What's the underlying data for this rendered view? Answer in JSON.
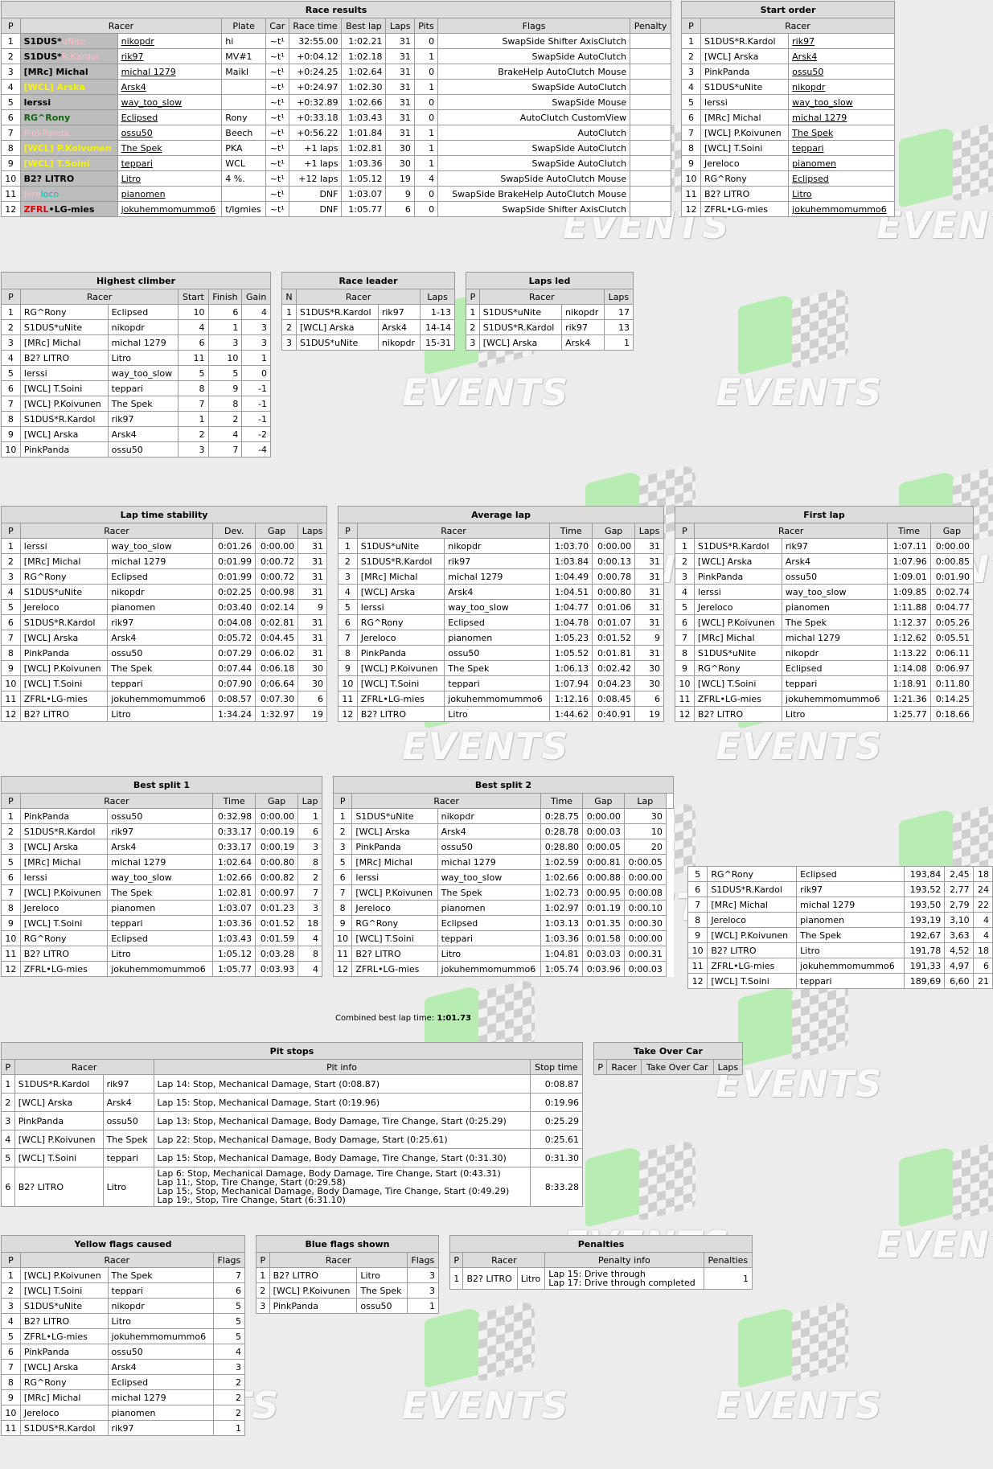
{
  "watermark": {
    "text": "EVENTS"
  },
  "race_results": {
    "title": "Race results",
    "columns": [
      "P",
      "Racer",
      "",
      "Plate",
      "Car",
      "Race time",
      "Best lap",
      "Laps",
      "Pits",
      "Flags",
      "Penalty"
    ],
    "rows": [
      {
        "p": "1",
        "racer_a": "S1DUS*",
        "racer_b": "uNite",
        "user": "nikopdr",
        "plate": "hi",
        "car": "~t¹",
        "time": "32:55.00",
        "best": "1:02.21",
        "laps": "31",
        "pits": "0",
        "flags": "SwapSide Shifter AxisClutch",
        "penalty": ""
      },
      {
        "p": "2",
        "racer_a": "S1DUS*",
        "racer_b": "R.Kardol",
        "user": "rik97",
        "plate": "MV#1",
        "car": "~t¹",
        "time": "+0:04.12",
        "best": "1:02.18",
        "laps": "31",
        "pits": "1",
        "flags": "SwapSide AutoClutch",
        "penalty": ""
      },
      {
        "p": "3",
        "racer_a": "[MR",
        "racer_b": "c] Michal",
        "user": "michal 1279",
        "plate": "Maikl",
        "car": "~t¹",
        "time": "+0:24.25",
        "best": "1:02.64",
        "laps": "31",
        "pits": "0",
        "flags": "BrakeHelp AutoClutch Mouse",
        "penalty": ""
      },
      {
        "p": "4",
        "racer_a": "[WCL]",
        "racer_b": " Arska",
        "user": "Arsk4",
        "plate": "",
        "car": "~t¹",
        "time": "+0:24.97",
        "best": "1:02.30",
        "laps": "31",
        "pits": "1",
        "flags": "SwapSide AutoClutch",
        "penalty": ""
      },
      {
        "p": "5",
        "racer_a": "lerssi",
        "racer_b": "",
        "user": "way_too_slow",
        "plate": "",
        "car": "~t¹",
        "time": "+0:32.89",
        "best": "1:02.66",
        "laps": "31",
        "pits": "0",
        "flags": "SwapSide Mouse",
        "penalty": ""
      },
      {
        "p": "6",
        "racer_a": "RG^",
        "racer_b": "Rony",
        "user": "Eclipsed",
        "plate": "Rony",
        "car": "~t¹",
        "time": "+0:33.18",
        "best": "1:03.43",
        "laps": "31",
        "pits": "0",
        "flags": "AutoClutch CustomView",
        "penalty": ""
      },
      {
        "p": "7",
        "racer_a": "Pink",
        "racer_b": "Panda",
        "user": "ossu50",
        "plate": "Beech",
        "car": "~t¹",
        "time": "+0:56.22",
        "best": "1:01.84",
        "laps": "31",
        "pits": "1",
        "flags": "AutoClutch",
        "penalty": ""
      },
      {
        "p": "8",
        "racer_a": "[WCL]",
        "racer_b": " P.Koivunen",
        "user": "The Spek",
        "plate": "PKA",
        "car": "~t¹",
        "time": "+1 laps",
        "best": "1:02.81",
        "laps": "30",
        "pits": "1",
        "flags": "SwapSide AutoClutch",
        "penalty": ""
      },
      {
        "p": "9",
        "racer_a": "[WCL]",
        "racer_b": " T.Soini",
        "user": "teppari",
        "plate": "WCL",
        "car": "~t¹",
        "time": "+1 laps",
        "best": "1:03.36",
        "laps": "30",
        "pits": "1",
        "flags": "SwapSide AutoClutch",
        "penalty": ""
      },
      {
        "p": "10",
        "racer_a": "B2?",
        "racer_b": " LITRO",
        "user": "Litro",
        "plate": "4 %.",
        "car": "~t¹",
        "time": "+12 laps",
        "best": "1:05.12",
        "laps": "19",
        "pits": "4",
        "flags": "SwapSide AutoClutch Mouse",
        "penalty": ""
      },
      {
        "p": "11",
        "racer_a": "Jere",
        "racer_b": "loco",
        "user": "pianomen",
        "plate": "",
        "car": "~t¹",
        "time": "DNF",
        "best": "1:03.07",
        "laps": "9",
        "pits": "0",
        "flags": "SwapSide BrakeHelp AutoClutch Mouse",
        "penalty": ""
      },
      {
        "p": "12",
        "racer_a": "ZFRL",
        "racer_b": "•LG-mies",
        "user": "jokuhemmomummo6",
        "plate": "t/lgmies",
        "car": "~t¹",
        "time": "DNF",
        "best": "1:05.77",
        "laps": "6",
        "pits": "0",
        "flags": "SwapSide Shifter AxisClutch",
        "penalty": ""
      }
    ]
  },
  "start_order": {
    "title": "Start order",
    "columns": [
      "P",
      "Racer"
    ],
    "rows": [
      [
        "1",
        "S1DUS*R.Kardol",
        "rik97"
      ],
      [
        "2",
        "[WCL] Arska",
        "Arsk4"
      ],
      [
        "3",
        "PinkPanda",
        "ossu50"
      ],
      [
        "4",
        "S1DUS*uNite",
        "nikopdr"
      ],
      [
        "5",
        "lerssi",
        "way_too_slow"
      ],
      [
        "6",
        "[MRc] Michal",
        "michal 1279"
      ],
      [
        "7",
        "[WCL] P.Koivunen",
        "The Spek"
      ],
      [
        "8",
        "[WCL] T.Soini",
        "teppari"
      ],
      [
        "9",
        "Jereloco",
        "pianomen"
      ],
      [
        "10",
        "RG^Rony",
        "Eclipsed"
      ],
      [
        "11",
        "B2? LITRO",
        "Litro"
      ],
      [
        "12",
        "ZFRL•LG-mies",
        "jokuhemmomummo6"
      ]
    ]
  },
  "highest_climber": {
    "title": "Highest climber",
    "columns": [
      "P",
      "Racer",
      "Start",
      "Finish",
      "Gain"
    ],
    "rows": [
      [
        "1",
        "RG^Rony",
        "Eclipsed",
        "10",
        "6",
        "4"
      ],
      [
        "2",
        "S1DUS*uNite",
        "nikopdr",
        "4",
        "1",
        "3"
      ],
      [
        "3",
        "[MRc] Michal",
        "michal 1279",
        "6",
        "3",
        "3"
      ],
      [
        "4",
        "B2? LITRO",
        "Litro",
        "11",
        "10",
        "1"
      ],
      [
        "5",
        "lerssi",
        "way_too_slow",
        "5",
        "5",
        "0"
      ],
      [
        "6",
        "[WCL] T.Soini",
        "teppari",
        "8",
        "9",
        "-1"
      ],
      [
        "7",
        "[WCL] P.Koivunen",
        "The Spek",
        "7",
        "8",
        "-1"
      ],
      [
        "8",
        "S1DUS*R.Kardol",
        "rik97",
        "1",
        "2",
        "-1"
      ],
      [
        "9",
        "[WCL] Arska",
        "Arsk4",
        "2",
        "4",
        "-2"
      ],
      [
        "10",
        "PinkPanda",
        "ossu50",
        "3",
        "7",
        "-4"
      ]
    ]
  },
  "race_leader": {
    "title": "Race leader",
    "columns": [
      "N",
      "Racer",
      "Laps"
    ],
    "rows": [
      [
        "1",
        "S1DUS*R.Kardol",
        "rik97",
        "1-13"
      ],
      [
        "2",
        "[WCL] Arska",
        "Arsk4",
        "14-14"
      ],
      [
        "3",
        "S1DUS*uNite",
        "nikopdr",
        "15-31"
      ]
    ]
  },
  "laps_led": {
    "title": "Laps led",
    "columns": [
      "P",
      "Racer",
      "Laps"
    ],
    "rows": [
      [
        "1",
        "S1DUS*uNite",
        "nikopdr",
        "17"
      ],
      [
        "2",
        "S1DUS*R.Kardol",
        "rik97",
        "13"
      ],
      [
        "3",
        "[WCL] Arska",
        "Arsk4",
        "1"
      ]
    ]
  },
  "lap_stability": {
    "title": "Lap time stability",
    "columns": [
      "P",
      "Racer",
      "Dev.",
      "Gap",
      "Laps"
    ],
    "rows": [
      [
        "1",
        "lerssi",
        "way_too_slow",
        "0:01.26",
        "0:00.00",
        "31"
      ],
      [
        "2",
        "[MRc] Michal",
        "michal 1279",
        "0:01.99",
        "0:00.72",
        "31"
      ],
      [
        "3",
        "RG^Rony",
        "Eclipsed",
        "0:01.99",
        "0:00.72",
        "31"
      ],
      [
        "4",
        "S1DUS*uNite",
        "nikopdr",
        "0:02.25",
        "0:00.98",
        "31"
      ],
      [
        "5",
        "Jereloco",
        "pianomen",
        "0:03.40",
        "0:02.14",
        "9"
      ],
      [
        "6",
        "S1DUS*R.Kardol",
        "rik97",
        "0:04.08",
        "0:02.81",
        "31"
      ],
      [
        "7",
        "[WCL] Arska",
        "Arsk4",
        "0:05.72",
        "0:04.45",
        "31"
      ],
      [
        "8",
        "PinkPanda",
        "ossu50",
        "0:07.29",
        "0:06.02",
        "31"
      ],
      [
        "9",
        "[WCL] P.Koivunen",
        "The Spek",
        "0:07.44",
        "0:06.18",
        "30"
      ],
      [
        "10",
        "[WCL] T.Soini",
        "teppari",
        "0:07.90",
        "0:06.64",
        "30"
      ],
      [
        "11",
        "ZFRL•LG-mies",
        "jokuhemmomummo6",
        "0:08.57",
        "0:07.30",
        "6"
      ],
      [
        "12",
        "B2? LITRO",
        "Litro",
        "1:34.24",
        "1:32.97",
        "19"
      ]
    ]
  },
  "average_lap": {
    "title": "Average lap",
    "columns": [
      "P",
      "Racer",
      "Time",
      "Gap",
      "Laps"
    ],
    "rows": [
      [
        "1",
        "S1DUS*uNite",
        "nikopdr",
        "1:03.70",
        "0:00.00",
        "31"
      ],
      [
        "2",
        "S1DUS*R.Kardol",
        "rik97",
        "1:03.84",
        "0:00.13",
        "31"
      ],
      [
        "3",
        "[MRc] Michal",
        "michal 1279",
        "1:04.49",
        "0:00.78",
        "31"
      ],
      [
        "4",
        "[WCL] Arska",
        "Arsk4",
        "1:04.51",
        "0:00.80",
        "31"
      ],
      [
        "5",
        "lerssi",
        "way_too_slow",
        "1:04.77",
        "0:01.06",
        "31"
      ],
      [
        "6",
        "RG^Rony",
        "Eclipsed",
        "1:04.78",
        "0:01.07",
        "31"
      ],
      [
        "7",
        "Jereloco",
        "pianomen",
        "1:05.23",
        "0:01.52",
        "9"
      ],
      [
        "8",
        "PinkPanda",
        "ossu50",
        "1:05.52",
        "0:01.81",
        "31"
      ],
      [
        "9",
        "[WCL] P.Koivunen",
        "The Spek",
        "1:06.13",
        "0:02.42",
        "30"
      ],
      [
        "10",
        "[WCL] T.Soini",
        "teppari",
        "1:07.94",
        "0:04.23",
        "30"
      ],
      [
        "11",
        "ZFRL•LG-mies",
        "jokuhemmomummo6",
        "1:12.16",
        "0:08.45",
        "6"
      ],
      [
        "12",
        "B2? LITRO",
        "Litro",
        "1:44.62",
        "0:40.91",
        "19"
      ]
    ]
  },
  "first_lap": {
    "title": "First lap",
    "columns": [
      "P",
      "Racer",
      "Time",
      "Gap"
    ],
    "rows": [
      [
        "1",
        "S1DUS*R.Kardol",
        "rik97",
        "1:07.11",
        "0:00.00"
      ],
      [
        "2",
        "[WCL] Arska",
        "Arsk4",
        "1:07.96",
        "0:00.85"
      ],
      [
        "3",
        "PinkPanda",
        "ossu50",
        "1:09.01",
        "0:01.90"
      ],
      [
        "4",
        "lerssi",
        "way_too_slow",
        "1:09.85",
        "0:02.74"
      ],
      [
        "5",
        "Jereloco",
        "pianomen",
        "1:11.88",
        "0:04.77"
      ],
      [
        "6",
        "[WCL] P.Koivunen",
        "The Spek",
        "1:12.37",
        "0:05.26"
      ],
      [
        "7",
        "[MRc] Michal",
        "michal 1279",
        "1:12.62",
        "0:05.51"
      ],
      [
        "8",
        "S1DUS*uNite",
        "nikopdr",
        "1:13.22",
        "0:06.11"
      ],
      [
        "9",
        "RG^Rony",
        "Eclipsed",
        "1:14.08",
        "0:06.97"
      ],
      [
        "10",
        "[WCL] T.Soini",
        "teppari",
        "1:18.91",
        "0:11.80"
      ],
      [
        "11",
        "ZFRL•LG-mies",
        "jokuhemmomummo6",
        "1:21.36",
        "0:14.25"
      ],
      [
        "12",
        "B2? LITRO",
        "Litro",
        "1:25.77",
        "0:18.66"
      ]
    ]
  },
  "best_split_1": {
    "title": "Best split 1",
    "columns": [
      "P",
      "Racer",
      "Time",
      "Gap",
      "Lap"
    ],
    "rows": [
      [
        "1",
        "PinkPanda",
        "ossu50",
        "0:32.98",
        "0:00.00",
        "1"
      ],
      [
        "2",
        "S1DUS*R.Kardol",
        "rik97",
        "0:33.17",
        "0:00.19",
        "6"
      ],
      [
        "3",
        "[WCL] Arska",
        "Arsk4",
        "0:33.17",
        "0:00.19",
        "3"
      ],
      [
        "5",
        "[MRc] Michal",
        "michal 1279",
        "1:02.64",
        "0:00.80",
        "8"
      ],
      [
        "6",
        "lerssi",
        "way_too_slow",
        "1:02.66",
        "0:00.82",
        "2"
      ],
      [
        "7",
        "[WCL] P.Koivunen",
        "The Spek",
        "1:02.81",
        "0:00.97",
        "7"
      ],
      [
        "8",
        "Jereloco",
        "pianomen",
        "1:03.07",
        "0:01.23",
        "3"
      ],
      [
        "9",
        "[WCL] T.Soini",
        "teppari",
        "1:03.36",
        "0:01.52",
        "18"
      ],
      [
        "10",
        "RG^Rony",
        "Eclipsed",
        "1:03.43",
        "0:01.59",
        "4"
      ],
      [
        "11",
        "B2? LITRO",
        "Litro",
        "1:05.12",
        "0:03.28",
        "8"
      ],
      [
        "12",
        "ZFRL•LG-mies",
        "jokuhemmomummo6",
        "1:05.77",
        "0:03.93",
        "4"
      ]
    ]
  },
  "best_split_2": {
    "title": "Best split 2",
    "columns": [
      "P",
      "Racer",
      "Time",
      "Gap",
      "Lap"
    ],
    "rows": [
      [
        "1",
        "S1DUS*uNite",
        "nikopdr",
        "0:28.75",
        "0:00.00",
        "30"
      ],
      [
        "2",
        "[WCL] Arska",
        "Arsk4",
        "0:28.78",
        "0:00.03",
        "10"
      ],
      [
        "3",
        "PinkPanda",
        "ossu50",
        "0:28.80",
        "0:00.05",
        "20"
      ],
      [
        "5",
        "[MRc] Michal",
        "michal 1279",
        "1:02.59",
        "0:00.81",
        "0:00.05"
      ],
      [
        "6",
        "lerssi",
        "way_too_slow",
        "1:02.66",
        "0:00.88",
        "0:00.00"
      ],
      [
        "7",
        "[WCL] P.Koivunen",
        "The Spek",
        "1:02.73",
        "0:00.95",
        "0:00.08"
      ],
      [
        "8",
        "Jereloco",
        "pianomen",
        "1:02.97",
        "0:01.19",
        "0:00.10"
      ],
      [
        "9",
        "RG^Rony",
        "Eclipsed",
        "1:03.13",
        "0:01.35",
        "0:00.30"
      ],
      [
        "10",
        "[WCL] T.Soini",
        "teppari",
        "1:03.36",
        "0:01.58",
        "0:00.00"
      ],
      [
        "11",
        "B2? LITRO",
        "Litro",
        "1:04.81",
        "0:03.03",
        "0:00.31"
      ],
      [
        "12",
        "ZFRL•LG-mies",
        "jokuhemmomummo6",
        "1:05.74",
        "0:03.96",
        "0:00.03"
      ]
    ]
  },
  "top_speed_partial": {
    "rows": [
      [
        "5",
        "RG^Rony",
        "Eclipsed",
        "193,84",
        "2,45",
        "18"
      ],
      [
        "6",
        "S1DUS*R.Kardol",
        "rik97",
        "193,52",
        "2,77",
        "24"
      ],
      [
        "7",
        "[MRc] Michal",
        "michal 1279",
        "193,50",
        "2,79",
        "22"
      ],
      [
        "8",
        "Jereloco",
        "pianomen",
        "193,19",
        "3,10",
        "4"
      ],
      [
        "9",
        "[WCL] P.Koivunen",
        "The Spek",
        "192,67",
        "3,63",
        "4"
      ],
      [
        "10",
        "B2? LITRO",
        "Litro",
        "191,78",
        "4,52",
        "18"
      ],
      [
        "11",
        "ZFRL•LG-mies",
        "jokuhemmomummo6",
        "191,33",
        "4,97",
        "6"
      ],
      [
        "12",
        "[WCL] T.Soini",
        "teppari",
        "189,69",
        "6,60",
        "21"
      ]
    ]
  },
  "combined_best": {
    "label": "Combined best lap time:",
    "value": "1:01.73"
  },
  "pit_stops": {
    "title": "Pit stops",
    "columns": [
      "P",
      "Racer",
      "Pit info",
      "Stop time"
    ],
    "rows": [
      {
        "p": "1",
        "racer": "S1DUS*R.Kardol",
        "user": "rik97",
        "info": [
          "Lap 14: Stop, Mechanical Damage, Start (0:08.87)"
        ],
        "time": "0:08.87"
      },
      {
        "p": "2",
        "racer": "[WCL] Arska",
        "user": "Arsk4",
        "info": [
          "Lap 15: Stop, Mechanical Damage, Start (0:19.96)"
        ],
        "time": "0:19.96"
      },
      {
        "p": "3",
        "racer": "PinkPanda",
        "user": "ossu50",
        "info": [
          "Lap 13: Stop, Mechanical Damage, Body Damage, Tire Change, Start (0:25.29)"
        ],
        "time": "0:25.29"
      },
      {
        "p": "4",
        "racer": "[WCL] P.Koivunen",
        "user": "The Spek",
        "info": [
          "Lap 22: Stop, Mechanical Damage, Body Damage, Start (0:25.61)"
        ],
        "time": "0:25.61"
      },
      {
        "p": "5",
        "racer": "[WCL] T.Soini",
        "user": "teppari",
        "info": [
          "Lap 15: Stop, Mechanical Damage, Body Damage, Tire Change, Start (0:31.30)"
        ],
        "time": "0:31.30"
      },
      {
        "p": "6",
        "racer": "B2? LITRO",
        "user": "Litro",
        "info": [
          "Lap 6: Stop, Mechanical Damage, Body Damage, Tire Change, Start (0:43.31)",
          "Lap 11:, Stop, Tire Change, Start (0:29.58)",
          "Lap 15:, Stop, Mechanical Damage, Body Damage, Tire Change, Start (0:49.29)",
          "Lap 19:, Stop, Tire Change, Start (6:31.10)"
        ],
        "time": "8:33.28"
      }
    ]
  },
  "take_over": {
    "title": "Take Over Car",
    "columns": [
      "P",
      "Racer",
      "Take Over Car",
      "Laps"
    ]
  },
  "yellow_flags": {
    "title": "Yellow flags caused",
    "columns": [
      "P",
      "Racer",
      "Flags"
    ],
    "rows": [
      [
        "1",
        "[WCL] P.Koivunen",
        "The Spek",
        "7"
      ],
      [
        "2",
        "[WCL] T.Soini",
        "teppari",
        "6"
      ],
      [
        "3",
        "S1DUS*uNite",
        "nikopdr",
        "5"
      ],
      [
        "4",
        "B2? LITRO",
        "Litro",
        "5"
      ],
      [
        "5",
        "ZFRL•LG-mies",
        "jokuhemmomummo6",
        "5"
      ],
      [
        "6",
        "PinkPanda",
        "ossu50",
        "4"
      ],
      [
        "7",
        "[WCL] Arska",
        "Arsk4",
        "3"
      ],
      [
        "8",
        "RG^Rony",
        "Eclipsed",
        "2"
      ],
      [
        "9",
        "[MRc] Michal",
        "michal 1279",
        "2"
      ],
      [
        "10",
        "Jereloco",
        "pianomen",
        "2"
      ],
      [
        "11",
        "S1DUS*R.Kardol",
        "rik97",
        "1"
      ]
    ]
  },
  "blue_flags": {
    "title": "Blue flags shown",
    "columns": [
      "P",
      "Racer",
      "Flags"
    ],
    "rows": [
      [
        "1",
        "B2? LITRO",
        "Litro",
        "3"
      ],
      [
        "2",
        "[WCL] P.Koivunen",
        "The Spek",
        "3"
      ],
      [
        "3",
        "PinkPanda",
        "ossu50",
        "1"
      ]
    ]
  },
  "penalties": {
    "title": "Penalties",
    "columns": [
      "P",
      "Racer",
      "Penalty info",
      "Penalties"
    ],
    "rows": [
      {
        "p": "1",
        "racer": "B2? LITRO",
        "user": "Litro",
        "info": [
          "Lap 15: Drive through",
          "Lap 17: Drive through completed"
        ],
        "count": "1"
      }
    ]
  }
}
